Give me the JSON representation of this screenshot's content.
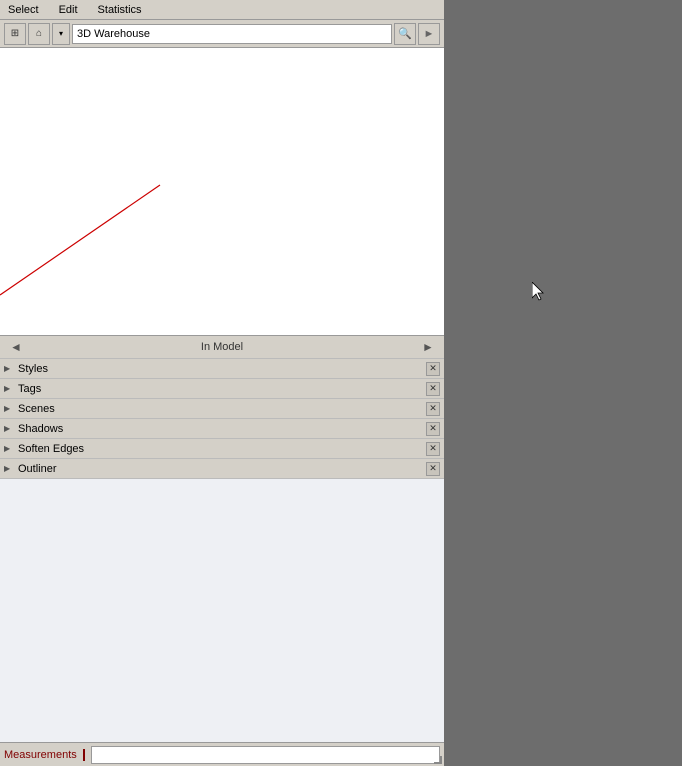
{
  "menu": {
    "items": [
      "Select",
      "Edit",
      "Statistics"
    ]
  },
  "toolbar": {
    "search_placeholder": "3D Warehouse",
    "search_value": "3D Warehouse"
  },
  "nav": {
    "label": "In Model",
    "back_arrow": "◄",
    "forward_arrow": "►"
  },
  "panels": [
    {
      "label": "Styles",
      "has_close": true
    },
    {
      "label": "Tags",
      "has_close": true
    },
    {
      "label": "Scenes",
      "has_close": true
    },
    {
      "label": "Shadows",
      "has_close": true
    },
    {
      "label": "Soften Edges",
      "has_close": true
    },
    {
      "label": "Outliner",
      "has_close": true
    }
  ],
  "measurements": {
    "label": "Measurements"
  },
  "icons": {
    "grid": "⊞",
    "home": "⌂",
    "dropdown": "▾",
    "search": "🔍",
    "forward": "►",
    "back": "◄",
    "close": "✕",
    "arrow_right": "▶"
  }
}
